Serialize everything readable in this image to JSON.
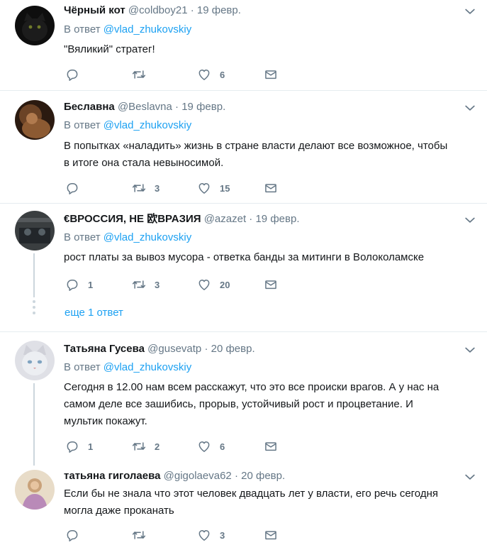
{
  "colors": {
    "accent": "#1da1f2",
    "muted": "#657786",
    "text": "#14171a",
    "divider": "#e6ecf0"
  },
  "reply_prefix": "В ответ",
  "tweets": [
    {
      "name": "Чёрный кот",
      "handle": "@coldboy21",
      "date": "19 февр.",
      "reply_to": "@vlad_zhukovskiy",
      "text": "\"Вяликий\" стратег!",
      "replies": "",
      "retweets": "",
      "likes": "6"
    },
    {
      "name": "Беславна",
      "handle": "@Beslavna",
      "date": "19 февр.",
      "reply_to": "@vlad_zhukovskiy",
      "text_lines": [
        "В попытках «наладить» жизнь в стране власти делают все возможное, чтобы",
        "в итоге она стала невыносимой."
      ],
      "replies": "",
      "retweets": "3",
      "likes": "15"
    },
    {
      "name": "€ВРОССИЯ, НЕ 欧ВРАЗИЯ",
      "handle": "@azazet",
      "date": "19 февр.",
      "reply_to": "@vlad_zhukovskiy",
      "text": "рост платы за вывоз мусора - ответка банды за митинги в Волоколамске",
      "replies": "1",
      "retweets": "3",
      "likes": "20",
      "more_replies": "еще 1 ответ"
    },
    {
      "name": "Татьяна Гусева",
      "handle": "@gusevatp",
      "date": "20 февр.",
      "reply_to": "@vlad_zhukovskiy",
      "text_lines": [
        "Сегодня в 12.00 нам всем расскажут, что это все происки врагов. А у нас на",
        "самом деле все зашибись, прорыв, устойчивый рост и процветание. И",
        "мультик покажут."
      ],
      "replies": "1",
      "retweets": "2",
      "likes": "6"
    },
    {
      "name": "татьяна гиголаева",
      "handle": "@gigolaeva62",
      "date": "20 февр.",
      "text_lines": [
        "Если бы не знала что этот человек двадцать лет у власти, его речь сегодня",
        "могла даже проканать"
      ],
      "replies": "",
      "retweets": "",
      "likes": "3"
    }
  ]
}
